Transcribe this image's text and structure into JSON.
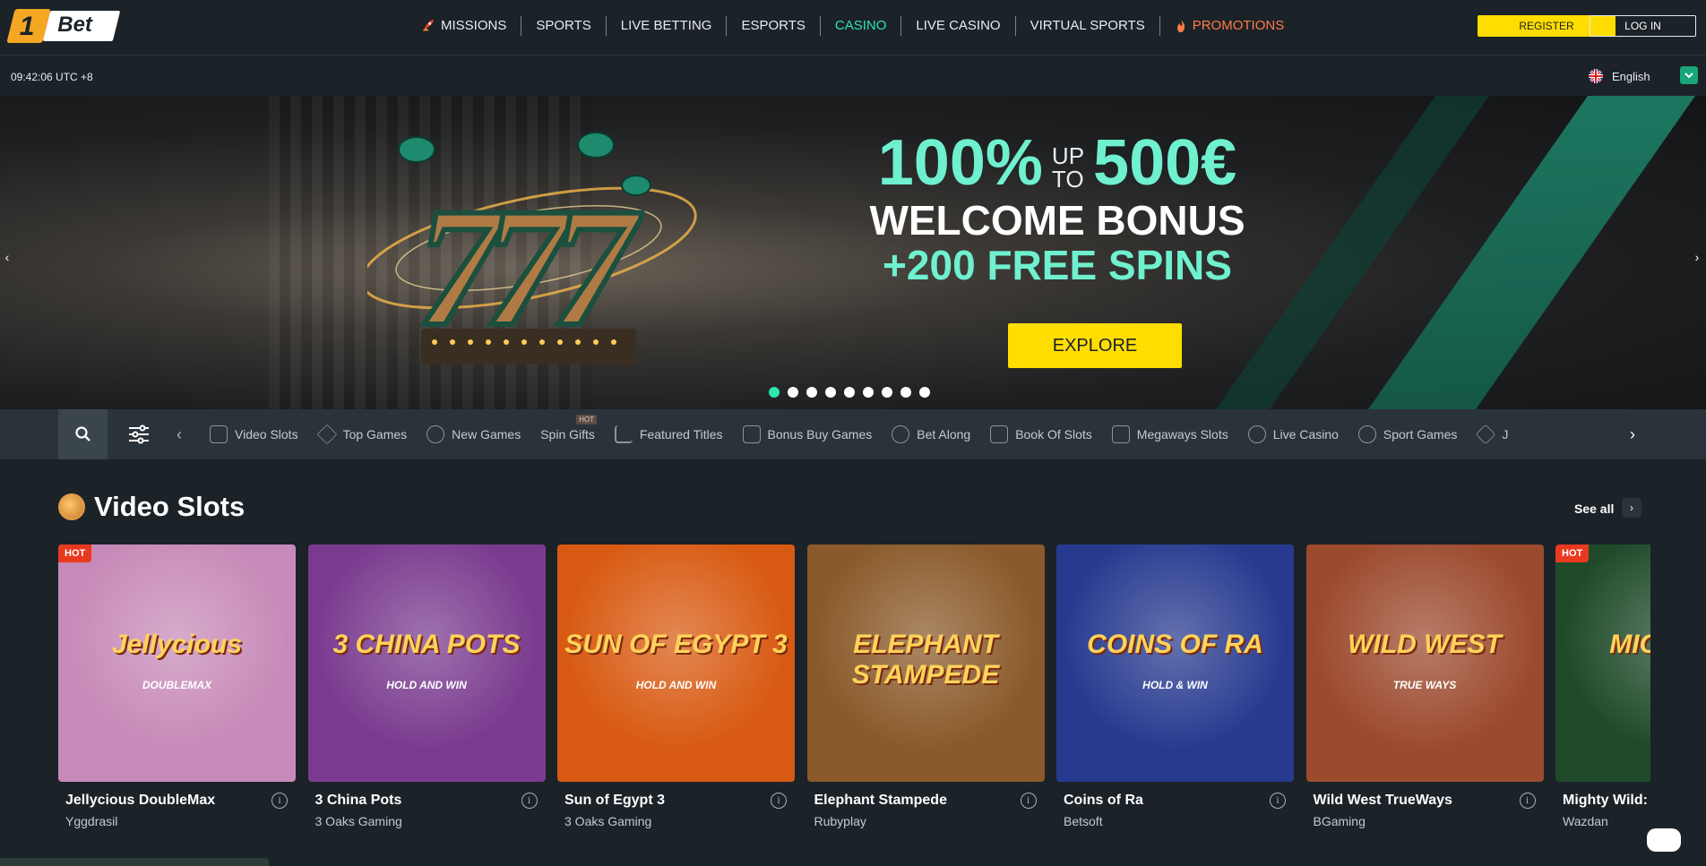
{
  "logo": {
    "one": "1",
    "bet": "Bet"
  },
  "nav": [
    {
      "label": "MISSIONS"
    },
    {
      "label": "SPORTS"
    },
    {
      "label": "LIVE BETTING"
    },
    {
      "label": "ESPORTS"
    },
    {
      "label": "CASINO"
    },
    {
      "label": "LIVE CASINO"
    },
    {
      "label": "VIRTUAL SPORTS"
    },
    {
      "label": "PROMOTIONS"
    }
  ],
  "auth": {
    "register": "REGISTER",
    "login": "LOG IN"
  },
  "subbar": {
    "clock": "09:42:06 UTC +8",
    "language": "English"
  },
  "hero": {
    "percent": "100%",
    "up": "UP",
    "to": "TO",
    "amount": "500€",
    "welcome": "WELCOME BONUS",
    "spins": "+200 FREE SPINS",
    "cta": "EXPLORE",
    "slides": 9,
    "active_slide": 1
  },
  "categories": [
    {
      "label": "Video Slots"
    },
    {
      "label": "Top Games"
    },
    {
      "label": "New Games"
    },
    {
      "label": "Spin Gifts",
      "tag": "HOT"
    },
    {
      "label": "Featured Titles"
    },
    {
      "label": "Bonus Buy Games"
    },
    {
      "label": "Bet Along"
    },
    {
      "label": "Book Of Slots"
    },
    {
      "label": "Megaways Slots"
    },
    {
      "label": "Live Casino"
    },
    {
      "label": "Sport Games"
    },
    {
      "label": "J"
    }
  ],
  "section": {
    "title": "Video Slots",
    "see_all": "See all"
  },
  "games": [
    {
      "name": "Jellycious DoubleMax",
      "provider": "Yggdrasil",
      "hot": "HOT",
      "art": "Jellycious",
      "art_sub": "DOUBLEMAX",
      "bg": "#c78ab8"
    },
    {
      "name": "3 China Pots",
      "provider": "3 Oaks Gaming",
      "hot": "",
      "art": "3 CHINA POTS",
      "art_sub": "HOLD AND WIN",
      "bg": "#7a3b8f"
    },
    {
      "name": "Sun of Egypt 3",
      "provider": "3 Oaks Gaming",
      "hot": "",
      "art": "SUN OF EGYPT 3",
      "art_sub": "HOLD AND WIN",
      "bg": "#d85a12"
    },
    {
      "name": "Elephant Stampede",
      "provider": "Rubyplay",
      "hot": "",
      "art": "ELEPHANT STAMPEDE",
      "art_sub": "",
      "bg": "#8a5a2a"
    },
    {
      "name": "Coins of Ra",
      "provider": "Betsoft",
      "hot": "",
      "art": "COINS OF RA",
      "art_sub": "HOLD & WIN",
      "bg": "#273a8f"
    },
    {
      "name": "Wild West TrueWays",
      "provider": "BGaming",
      "hot": "",
      "art": "WILD WEST",
      "art_sub": "TRUE WAYS",
      "bg": "#9c4a2e"
    },
    {
      "name": "Mighty Wild:",
      "provider": "Wazdan",
      "hot": "HOT",
      "art": "MIGHT PA",
      "art_sub": "",
      "bg": "#1f4a2a"
    }
  ]
}
